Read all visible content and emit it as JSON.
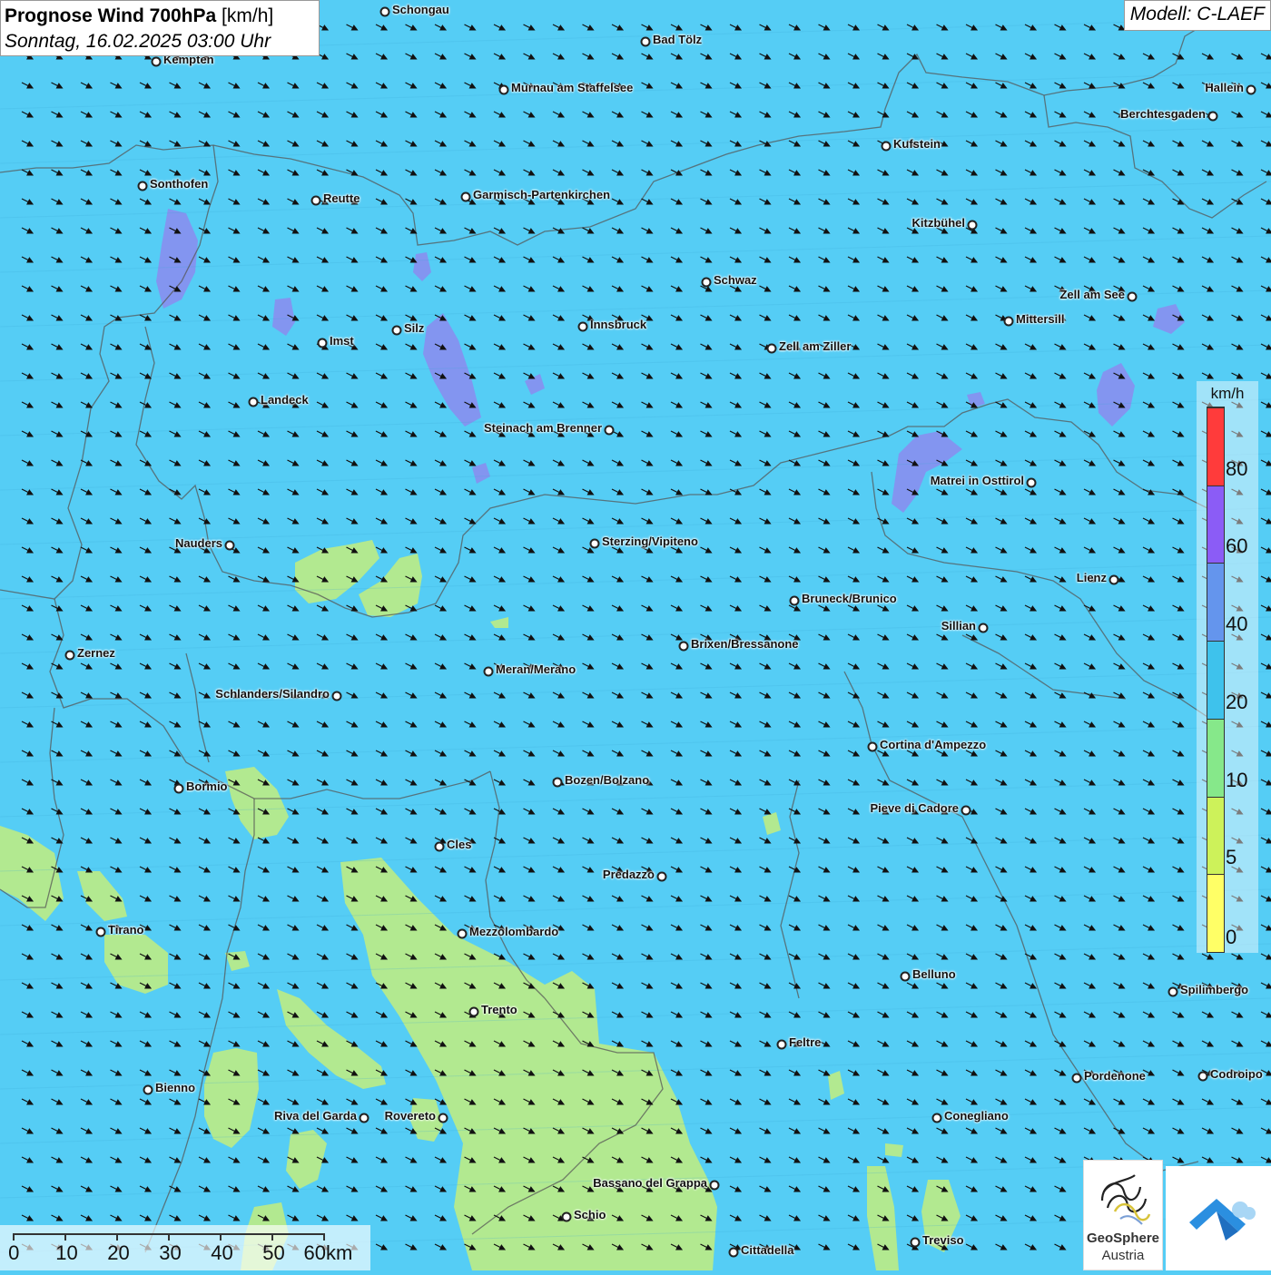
{
  "title": {
    "bold": "Prognose Wind 700hPa",
    "unit": "[km/h]",
    "datetime": "Sonntag, 16.02.2025 03:00 Uhr"
  },
  "model": "Modell: C-LAEF",
  "legend": {
    "unit": "km/h",
    "ticks": [
      "80",
      "60",
      "40",
      "20",
      "10",
      "5",
      "0"
    ],
    "colors": [
      "#ff3b3b",
      "#8b5cf6",
      "#6495ed",
      "#3ec2ec",
      "#86e88a",
      "#cdf25a",
      "#ffff66"
    ]
  },
  "scalebar": {
    "labels": [
      "0",
      "10",
      "20",
      "30",
      "40",
      "50",
      "60km"
    ]
  },
  "logo": {
    "name": "GeoSphere",
    "sub": "Austria"
  },
  "wind_field": {
    "direction": "northwest to southeast",
    "predominant_range_kmh": "20-40"
  },
  "colors": {
    "base_field": "#55cdf5",
    "low_wind": "#b7ea8a",
    "high_wind": "#8c8bee"
  },
  "cities": [
    {
      "name": "Schongau"
    },
    {
      "name": "Bad Tölz"
    },
    {
      "name": "Kempten"
    },
    {
      "name": "Murnau am Staffelsee"
    },
    {
      "name": "Hallein"
    },
    {
      "name": "Berchtesgaden"
    },
    {
      "name": "Kufstein"
    },
    {
      "name": "Sonthofen"
    },
    {
      "name": "Reutte"
    },
    {
      "name": "Garmisch-Partenkirchen"
    },
    {
      "name": "Kitzbühel"
    },
    {
      "name": "Schwaz"
    },
    {
      "name": "Zell am See"
    },
    {
      "name": "Mittersill"
    },
    {
      "name": "Imst"
    },
    {
      "name": "Silz"
    },
    {
      "name": "Innsbruck"
    },
    {
      "name": "Zell am Ziller"
    },
    {
      "name": "Landeck"
    },
    {
      "name": "Steinach am Brenner"
    },
    {
      "name": "Matrei in Osttirol"
    },
    {
      "name": "Nauders"
    },
    {
      "name": "Sterzing/Vipiteno"
    },
    {
      "name": "Lienz"
    },
    {
      "name": "Bruneck/Brunico"
    },
    {
      "name": "Sillian"
    },
    {
      "name": "Zernez"
    },
    {
      "name": "Brixen/Bressanone"
    },
    {
      "name": "Meran/Merano"
    },
    {
      "name": "Schlanders/Silandro"
    },
    {
      "name": "Cortina d'Ampezzo"
    },
    {
      "name": "Bozen/Bolzano"
    },
    {
      "name": "Bormio"
    },
    {
      "name": "Pieve di Cadore"
    },
    {
      "name": "Cles"
    },
    {
      "name": "Predazzo"
    },
    {
      "name": "Tirano"
    },
    {
      "name": "Mezzolombardo"
    },
    {
      "name": "Belluno"
    },
    {
      "name": "Spilimbergo"
    },
    {
      "name": "Trento"
    },
    {
      "name": "Feltre"
    },
    {
      "name": "Bienno"
    },
    {
      "name": "Pordenone"
    },
    {
      "name": "Codroipo"
    },
    {
      "name": "Riva del Garda"
    },
    {
      "name": "Rovereto"
    },
    {
      "name": "Conegliano"
    },
    {
      "name": "Bassano del Grappa"
    },
    {
      "name": "Schio"
    },
    {
      "name": "Treviso"
    },
    {
      "name": "Cittadella"
    }
  ]
}
